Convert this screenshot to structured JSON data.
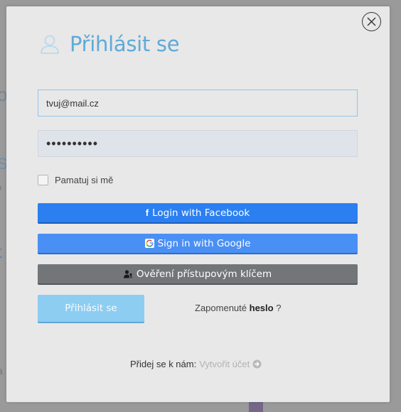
{
  "background": {
    "fragments": [
      "o",
      "S",
      "a",
      "t",
      "a"
    ]
  },
  "modal": {
    "close_icon": "close-icon",
    "title_icon": "user-icon",
    "title": "Přihlásit se",
    "email": {
      "value": "tvuj@mail.cz",
      "placeholder": ""
    },
    "password": {
      "value": "••••••••••"
    },
    "remember_label": "Pamatuj si mě",
    "facebook": {
      "icon": "facebook-icon",
      "label": "Login with Facebook"
    },
    "google": {
      "icon": "google-icon",
      "label": "Sign in with Google"
    },
    "passkey": {
      "icon": "user-key-icon",
      "label": "Ověření přístupovým klíčem"
    },
    "login_button": "Přihlásit se",
    "forgot": {
      "prefix": "Zapomenuté",
      "link": "heslo",
      "suffix": "?"
    },
    "signup": {
      "prompt": "Přidej se k nám:",
      "link": "Vytvořit účet",
      "icon": "arrow-right-circle-icon"
    }
  },
  "colors": {
    "title": "#5eaad8",
    "facebook": "#2b7ff0",
    "google": "#4a8ff4",
    "passkey": "#727679",
    "login": "#8dcdf2"
  }
}
